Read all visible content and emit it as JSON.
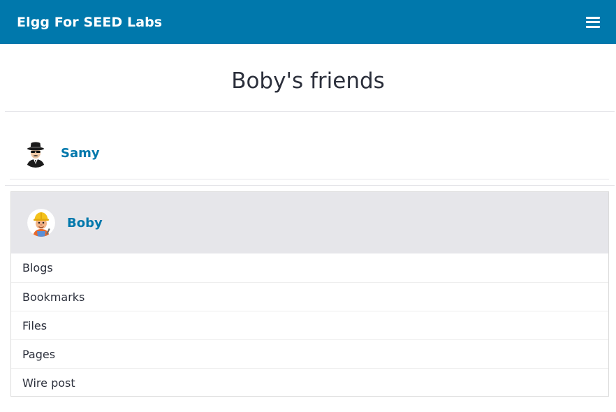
{
  "header": {
    "site_title": "Elgg For SEED Labs",
    "menu_icon": "hamburger-icon",
    "background": "#0078ac"
  },
  "page": {
    "title": "Boby's friends"
  },
  "friends": [
    {
      "name": "Samy",
      "avatar": "spy-avatar"
    }
  ],
  "owner": {
    "name": "Boby",
    "avatar": "builder-avatar",
    "menu": [
      "Blogs",
      "Bookmarks",
      "Files",
      "Pages",
      "Wire post"
    ]
  },
  "colors": {
    "link": "#0078ac",
    "owner_header_bg": "#e6e6ea"
  }
}
